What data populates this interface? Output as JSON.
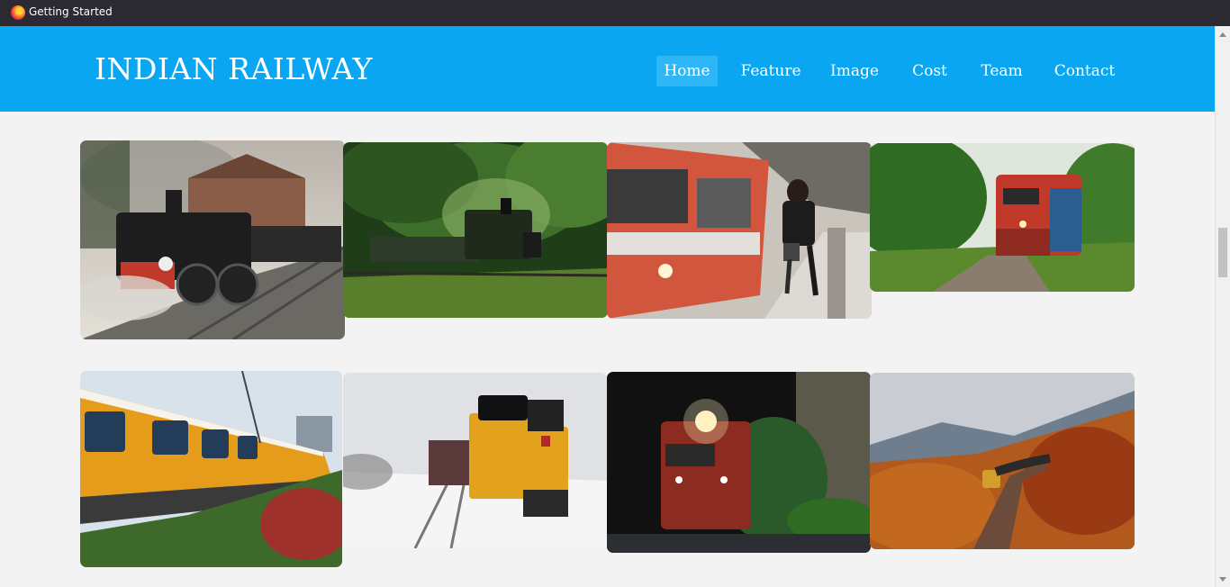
{
  "window": {
    "title": "Getting Started",
    "browser_icon": "firefox-icon"
  },
  "header": {
    "brand": "INDIAN RAILWAY",
    "nav": [
      {
        "label": "Home",
        "active": true
      },
      {
        "label": "Feature",
        "active": false
      },
      {
        "label": "Image",
        "active": false
      },
      {
        "label": "Cost",
        "active": false
      },
      {
        "label": "Team",
        "active": false
      },
      {
        "label": "Contact",
        "active": false
      }
    ]
  },
  "colors": {
    "navbar": "#0aa6f2",
    "active_nav": "#2fb6f6",
    "page_bg": "#f3f3f3",
    "titlebar": "#2b2a33"
  },
  "gallery": [
    {
      "name": "steam-locomotive-station-photo"
    },
    {
      "name": "steam-train-forest-photo"
    },
    {
      "name": "couple-platform-train-photo"
    },
    {
      "name": "red-diesel-locomotive-photo"
    },
    {
      "name": "tejas-express-coach-photo"
    },
    {
      "name": "snow-freight-locomotive-photo"
    },
    {
      "name": "train-tunnel-photo"
    },
    {
      "name": "autumn-bridge-train-photo"
    }
  ]
}
